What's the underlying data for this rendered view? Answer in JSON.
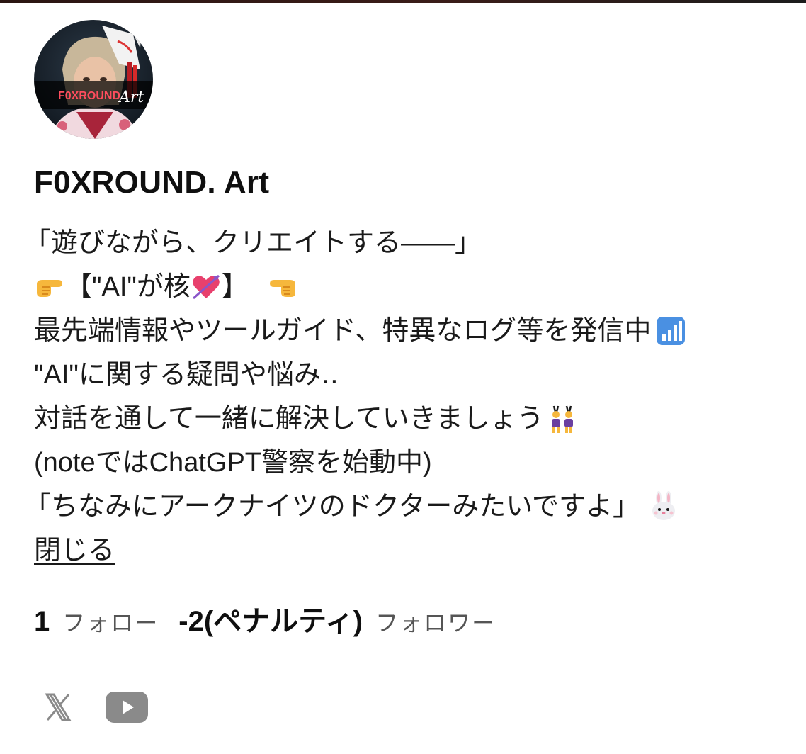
{
  "profile": {
    "avatar_text": "F0XROUND",
    "avatar_script": "Art",
    "display_name": "F0XROUND. Art",
    "bio_lines": [
      {
        "text_before": "「遊びながら、クリエイトする――」",
        "emoji_after": null,
        "indent_quote": true
      },
      {
        "emoji_before": "backhand-pointing-right-emoji",
        "text_before": "【\"AI\"が核",
        "emoji_mid": "heart-with-arrow-emoji",
        "text_after": "】",
        "emoji_after": "backhand-pointing-left-emoji"
      },
      {
        "text_before": "最先端情報やツールガイド、特異なログ等を発信中",
        "emoji_after": "bar-chart-emoji"
      },
      {
        "text_before": "\"AI\"に関する疑問や悩み‥"
      },
      {
        "text_before": "対話を通して一緒に解決していきましょう",
        "emoji_after": "people-with-bunny-ears-emoji"
      },
      {
        "text_before": "(noteではChatGPT警察を始動中)"
      },
      {
        "text_before": "「ちなみにアークナイツのドクターみたいですよ」",
        "emoji_after": "rabbit-face-emoji",
        "indent_quote": true
      }
    ],
    "close_label": "閉じる"
  },
  "stats": {
    "following_count": "1",
    "following_label": "フォロー",
    "followers_count": "-2(ペナルティ)",
    "followers_label": "フォロワー"
  },
  "socials": [
    {
      "name": "x-icon"
    },
    {
      "name": "youtube-icon"
    }
  ],
  "colors": {
    "text": "#1a1a1a",
    "muted": "#555555",
    "icon_gray": "#8a8a8a"
  }
}
